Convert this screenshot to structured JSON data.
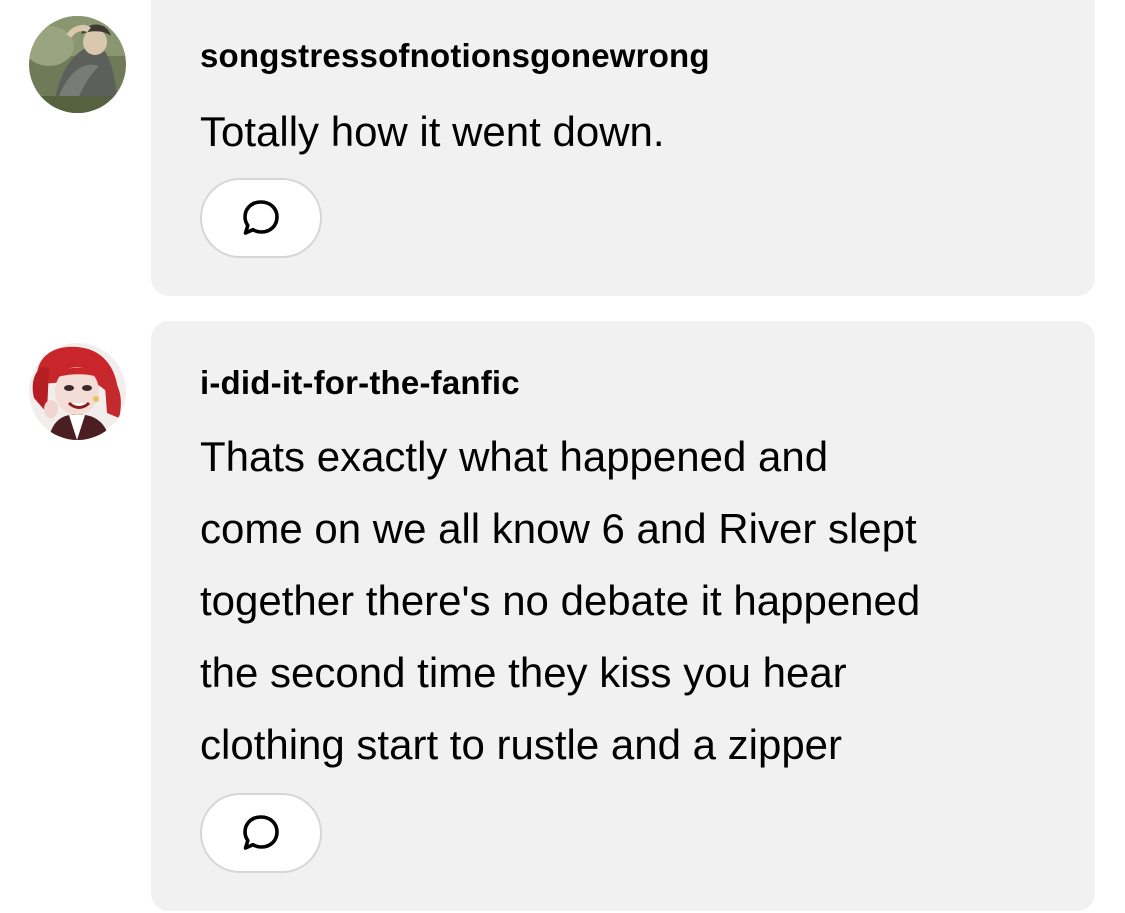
{
  "replies": [
    {
      "username": "songstressofnotionsgonewrong",
      "avatar_icon": "avatar-image",
      "lines": [
        "Totally how it went down."
      ],
      "reply_icon": "speech-bubble-icon"
    },
    {
      "username": "i-did-it-for-the-fanfic",
      "avatar_icon": "avatar-image",
      "lines": [
        "Thats exactly what happened and",
        "come on we all know 6 and River slept",
        "together there's no debate it happened",
        "the second time they kiss you hear",
        "clothing start to rustle and a zipper"
      ],
      "reply_icon": "speech-bubble-icon"
    }
  ],
  "colors": {
    "bubble_background": "#f1f1f1",
    "button_border": "#d6d6d6",
    "text": "#000000"
  }
}
